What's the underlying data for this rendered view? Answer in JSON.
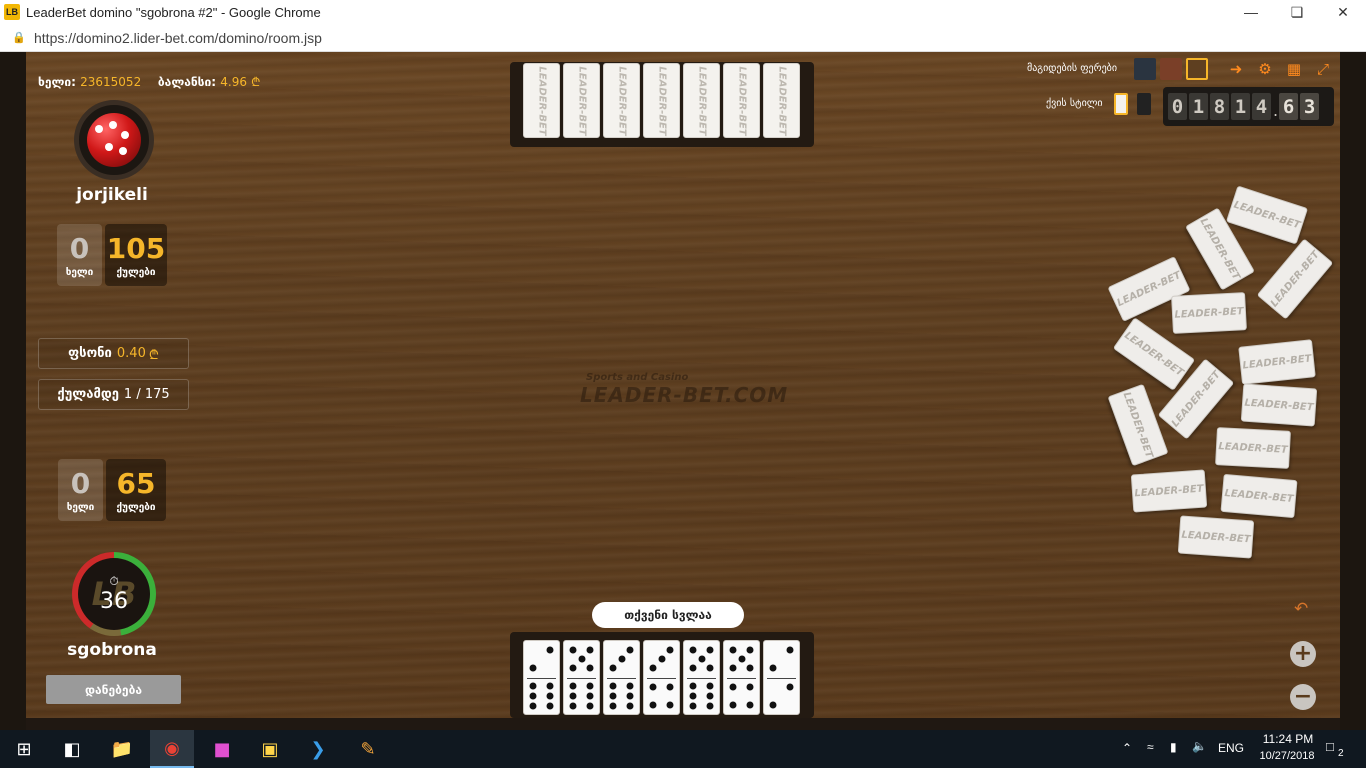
{
  "window": {
    "title": "LeaderBet domino \"sgobrona #2\" - Google Chrome",
    "app_icon": "LB",
    "url": "https://domino2.lider-bet.com/domino/room.jsp"
  },
  "header": {
    "hand_label": "ხელი:",
    "hand_value": "23615052",
    "balance_label": "ბალანსი:",
    "balance_value": "4.96"
  },
  "opponent": {
    "name": "jorjikeli",
    "hands": "0",
    "hands_label": "ხელი",
    "points": "105",
    "points_label": "ქულები"
  },
  "stake": {
    "label": "ფსონი",
    "value": "0.40"
  },
  "target": {
    "label": "ქულამდე",
    "value": "1 / 175"
  },
  "player": {
    "name": "sgobrona",
    "hands": "0",
    "hands_label": "ხელი",
    "points": "65",
    "points_label": "ქულები",
    "timer_seconds": "36",
    "give_up_label": "დანებება"
  },
  "settings": {
    "table_color_label": "მაგიდების ფერები",
    "domino_style_label": "ქვის სტილი",
    "balance_digits": [
      "0",
      "1",
      "8",
      "1",
      "4"
    ],
    "balance_decimals": [
      "6",
      "3"
    ],
    "balance_dot": "."
  },
  "board": {
    "watermark_small": "Sports and Casino",
    "watermark_big": "LEADER-BET.COM",
    "turn_message": "თქვენი სვლაა",
    "tile_back_text": "LEADER-BET",
    "opponent_tile_count": 7,
    "player_tiles": [
      [
        2,
        6
      ],
      [
        5,
        6
      ],
      [
        3,
        6
      ],
      [
        3,
        4
      ],
      [
        5,
        6
      ],
      [
        5,
        4
      ],
      [
        2,
        2
      ]
    ]
  },
  "taskbar": {
    "time": "11:24 PM",
    "date": "10/27/2018",
    "lang": "ENG",
    "notifications": "2"
  }
}
